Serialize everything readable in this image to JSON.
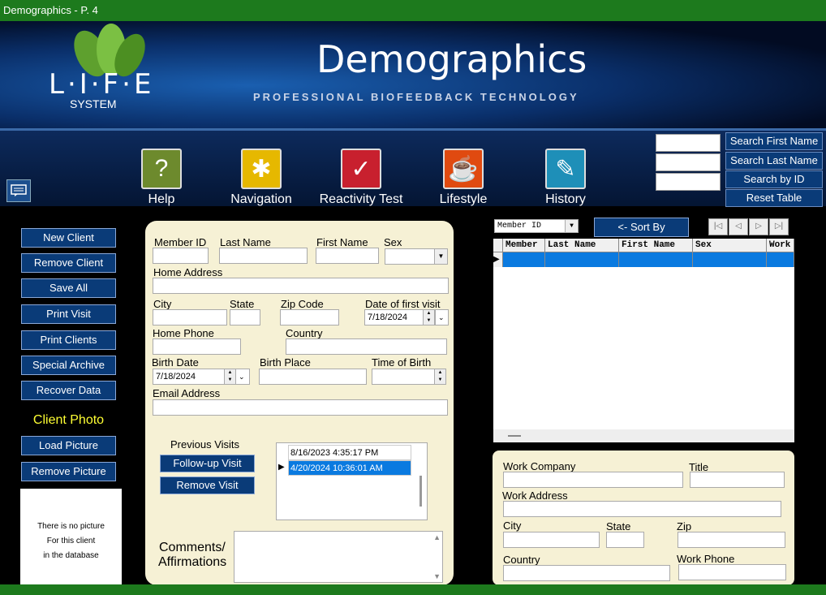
{
  "window": {
    "title": "Demographics - P. 4"
  },
  "banner": {
    "title": "Demographics",
    "subtitle": "PROFESSIONAL BIOFEEDBACK TECHNOLOGY",
    "logo_text": "L·I·F·E",
    "logo_sub": "SYSTEM"
  },
  "toolbar": {
    "help": "Help",
    "navigation": "Navigation",
    "reactivity": "Reactivity Test",
    "lifestyle": "Lifestyle",
    "history": "History"
  },
  "search": {
    "first": "Search First Name",
    "last": "Search Last Name",
    "id": "Search by ID",
    "reset": "Reset Table"
  },
  "left": {
    "new_client": "New Client",
    "remove_client": "Remove Client",
    "save_all": "Save All",
    "print_visit": "Print Visit",
    "print_clients": "Print Clients",
    "special_archive": "Special Archive",
    "recover_data": "Recover Data",
    "photo_label": "Client Photo",
    "load_picture": "Load Picture",
    "remove_picture": "Remove Picture",
    "no_pic_1": "There is no picture",
    "no_pic_2": "For this client",
    "no_pic_3": "in the database"
  },
  "form": {
    "member_id": "Member ID",
    "last_name": "Last Name",
    "first_name": "First Name",
    "sex": "Sex",
    "home_address": "Home Address",
    "city": "City",
    "state": "State",
    "zip": "Zip Code",
    "first_visit": "Date of first visit",
    "first_visit_value": "7/18/2024",
    "home_phone": "Home Phone",
    "country": "Country",
    "birth_date": "Birth Date",
    "birth_date_value": "7/18/2024",
    "birth_place": "Birth Place",
    "time_of_birth": "Time of Birth",
    "email": "Email Address",
    "previous_visits": "Previous Visits",
    "followup": "Follow-up Visit",
    "remove_visit": "Remove Visit",
    "comments_1": "Comments/",
    "comments_2": "Affirmations"
  },
  "visits": [
    "8/16/2023 4:35:17 PM",
    "4/20/2024 10:36:01 AM"
  ],
  "grid": {
    "sort_field": "Member ID",
    "sort_by": "<- Sort By",
    "columns": [
      "Member",
      "Last Name",
      "First Name",
      "Sex",
      "Work"
    ]
  },
  "work": {
    "company": "Work Company",
    "title": "Title",
    "address": "Work Address",
    "city": "City",
    "state": "State",
    "zip": "Zip",
    "country": "Country",
    "phone": "Work Phone"
  }
}
